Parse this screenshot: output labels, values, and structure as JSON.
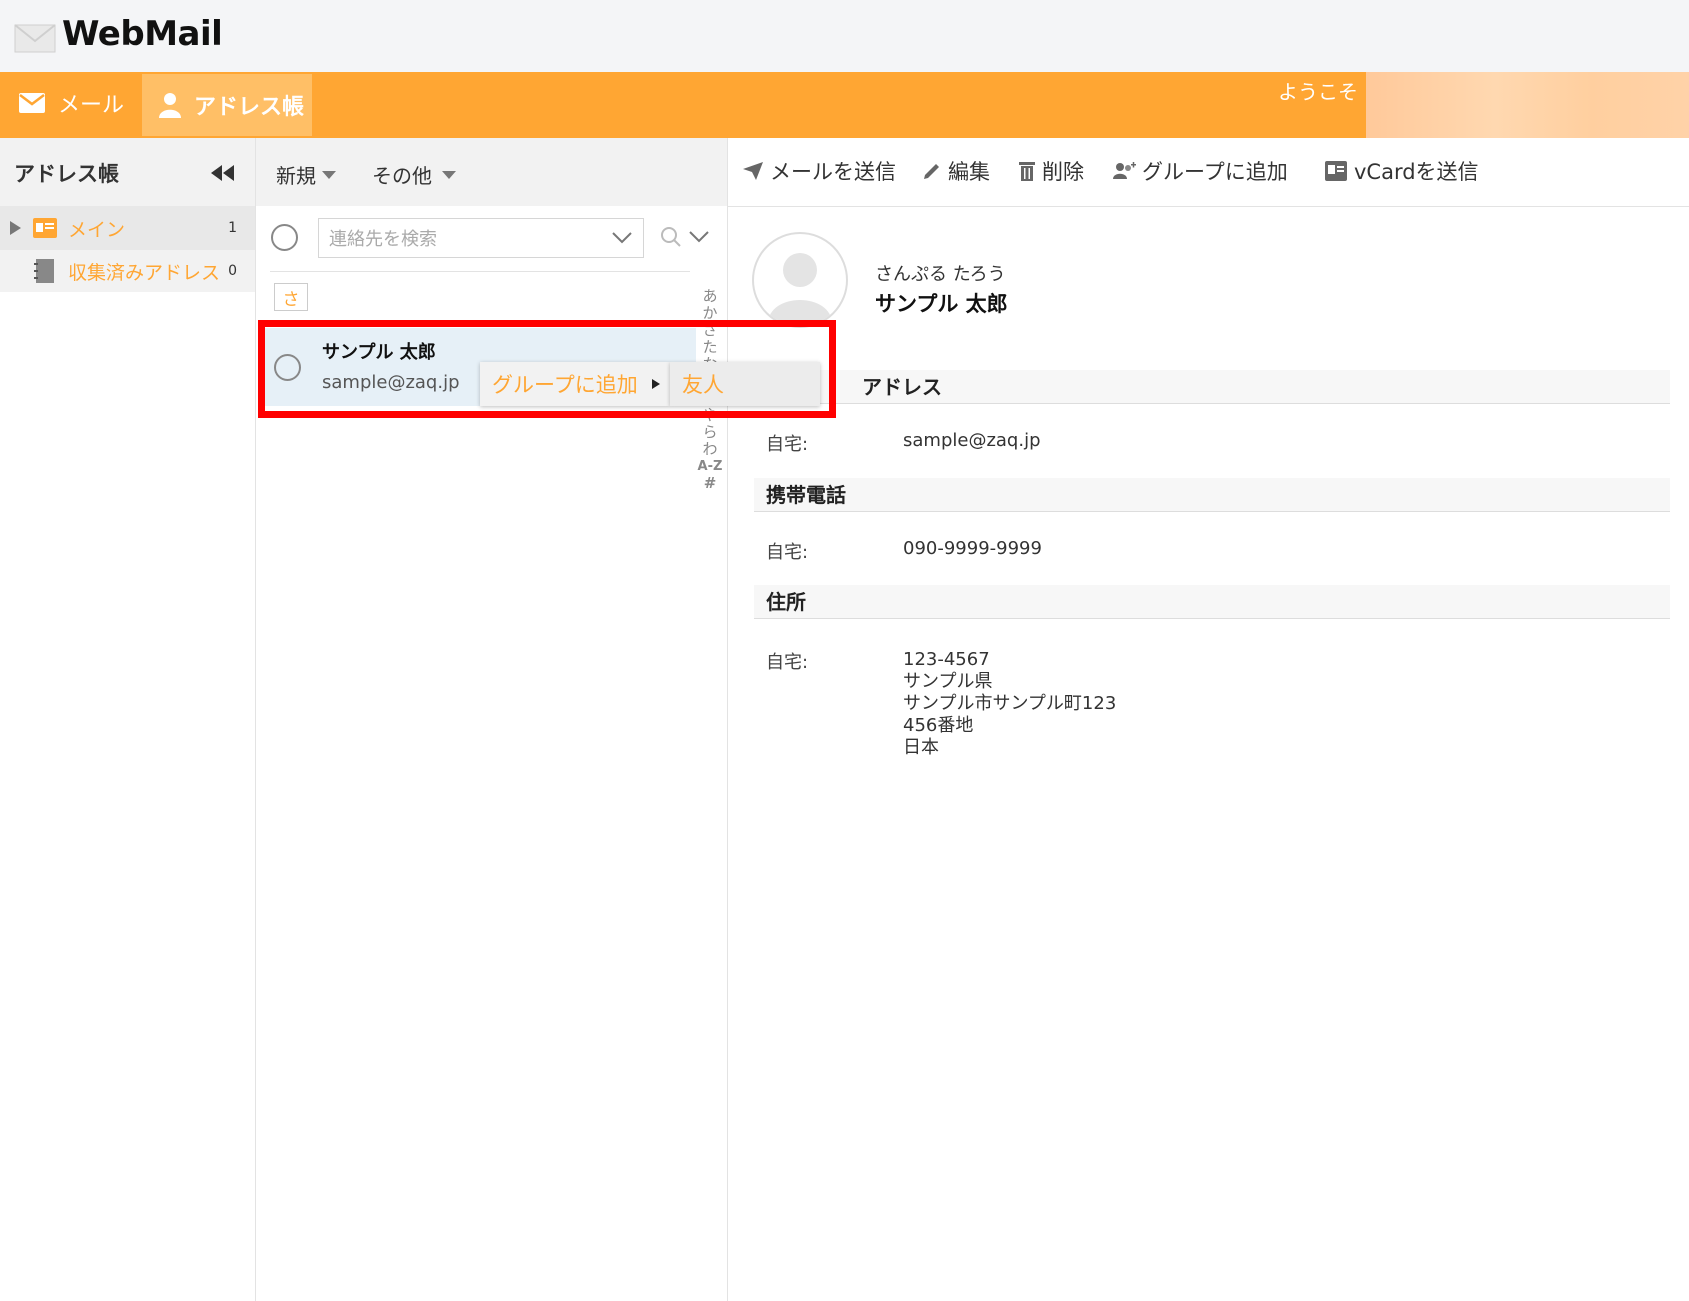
{
  "app": {
    "logo": "WebMail"
  },
  "nav": {
    "mail_label": "メール",
    "address_label": "アドレス帳",
    "welcome": "ようこそ"
  },
  "sidebar": {
    "title": "アドレス帳",
    "items": [
      {
        "label": "メイン",
        "count": "1"
      },
      {
        "label": "収集済みアドレス",
        "count": "0"
      }
    ]
  },
  "list": {
    "toolbar": {
      "new_label": "新規",
      "other_label": "その他"
    },
    "search_placeholder": "連絡先を検索",
    "section_letter": "さ",
    "contact": {
      "name": "サンプル 太郎",
      "email": "sample@zaq.jp"
    },
    "alpha_index": [
      "あ",
      "か",
      "さ",
      "た",
      "な",
      "は",
      "ま",
      "や",
      "ら",
      "わ",
      "A-Z",
      "#"
    ]
  },
  "context_menu": {
    "item": "グループに追加",
    "submenu_item": "友人"
  },
  "detail": {
    "toolbar": {
      "send_mail": "メールを送信",
      "edit": "編集",
      "delete": "削除",
      "add_to_group": "グループに追加",
      "send_vcard": "vCardを送信"
    },
    "reading": "さんぷる たろう",
    "name": "サンプル 太郎",
    "sections": {
      "email": {
        "title": "アドレス",
        "label": "自宅:",
        "value": "sample@zaq.jp"
      },
      "mobile": {
        "title": "携帯電話",
        "label": "自宅:",
        "value": "090-9999-9999"
      },
      "address": {
        "title": "住所",
        "label": "自宅:",
        "lines": [
          "123-4567",
          "サンプル県",
          "サンプル市サンプル町123",
          "456番地",
          "日本"
        ]
      }
    }
  },
  "colors": {
    "accent": "#ffa633",
    "highlight": "#ff0000"
  }
}
